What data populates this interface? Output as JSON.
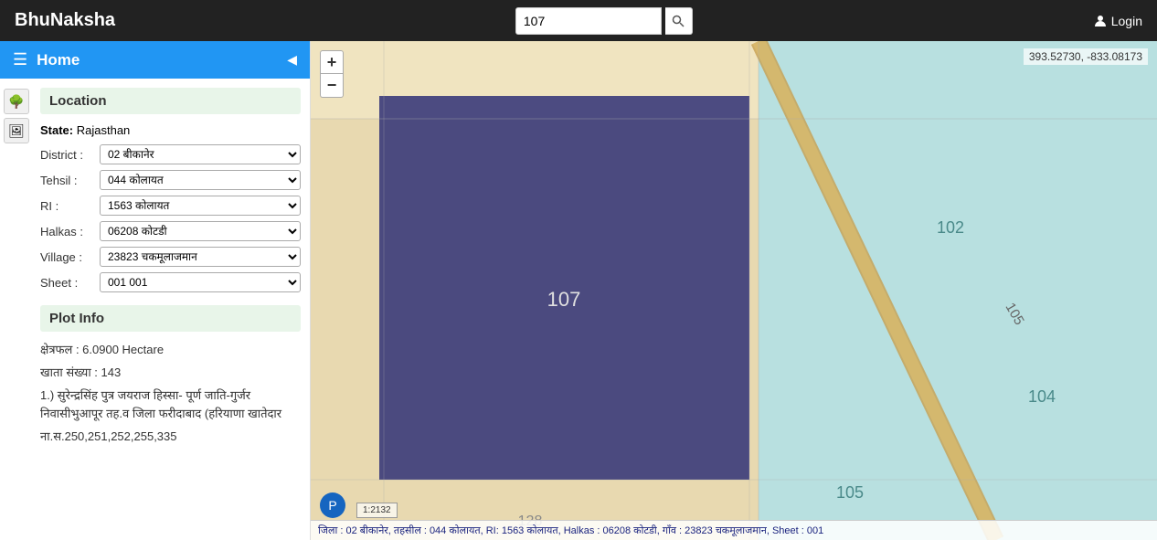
{
  "navbar": {
    "brand": "BhuNaksha",
    "search_value": "107",
    "search_placeholder": "Search",
    "login_label": "Login"
  },
  "sidebar": {
    "home_label": "Home",
    "collapse_arrow": "◀",
    "icons": [
      "🌳",
      "🖼"
    ],
    "location_section_title": "Location",
    "state_label": "State:",
    "state_value": "Rajasthan",
    "district_label": "District :",
    "district_options": [
      "02 बीकानेर"
    ],
    "district_selected": "02 बीकानेर",
    "tehsil_label": "Tehsil :",
    "tehsil_options": [
      "044 कोलायत"
    ],
    "tehsil_selected": "044 कोलायत",
    "ri_label": "RI :",
    "ri_options": [
      "1563 कोलायत"
    ],
    "ri_selected": "1563 कोलायत",
    "halkas_label": "Halkas :",
    "halkas_options": [
      "06208 कोटडी"
    ],
    "halkas_selected": "06208 कोटडी",
    "village_label": "Village :",
    "village_options": [
      "23823 चकमूलाजमान"
    ],
    "village_selected": "23823 चकमूलाजमान",
    "sheet_label": "Sheet :",
    "sheet_options": [
      "001 001"
    ],
    "sheet_selected": "001 001",
    "plot_info_title": "Plot Info",
    "area_label": "क्षेत्रफल : 6.0900 Hectare",
    "account_label": "खाता संख्या : 143",
    "owner_info": "1.) सुरेन्द्रसिंह पुत्र जयराज हिस्सा- पूर्ण जाति-गुर्जर निवासीभुआपूर तह.व जिला फरीदाबाद (हरियाणा खातेदार",
    "plot_numbers": "ना.स.250,251,252,255,335"
  },
  "map": {
    "coords": "393.52730, -833.08173",
    "zoom_plus": "+",
    "zoom_minus": "−",
    "plot_number": "107",
    "nearby_plots": [
      "102",
      "104",
      "105"
    ],
    "road_label": "105",
    "status_bar": "जिला : 02 बीकानेर, तहसील : 044 कोलायत, RI: 1563 कोलायत, Halkas : 06208 कोटडी, गाँव : 23823 चकमूलाजमान, Sheet : 001",
    "scale_label": "1:2132",
    "pin_icon": "P"
  }
}
